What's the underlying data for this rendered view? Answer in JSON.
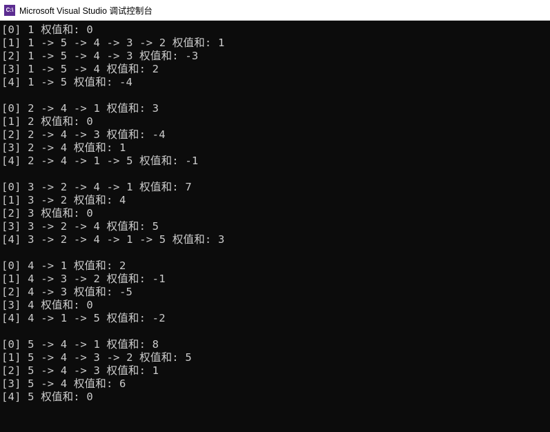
{
  "window": {
    "icon_label": "C:\\",
    "title": "Microsoft Visual Studio 调试控制台"
  },
  "weight_label": "权值和:",
  "arrow": "->",
  "blocks": [
    {
      "rows": [
        {
          "idx": "[0]",
          "path": "1",
          "weight": "0"
        },
        {
          "idx": "[1]",
          "path": "1 -> 5 -> 4 -> 3 -> 2",
          "weight": "1"
        },
        {
          "idx": "[2]",
          "path": "1 -> 5 -> 4 -> 3",
          "weight": "-3"
        },
        {
          "idx": "[3]",
          "path": "1 -> 5 -> 4",
          "weight": "2"
        },
        {
          "idx": "[4]",
          "path": "1 -> 5",
          "weight": "-4"
        }
      ]
    },
    {
      "rows": [
        {
          "idx": "[0]",
          "path": "2 -> 4 -> 1",
          "weight": "3"
        },
        {
          "idx": "[1]",
          "path": "2",
          "weight": "0"
        },
        {
          "idx": "[2]",
          "path": "2 -> 4 -> 3",
          "weight": "-4"
        },
        {
          "idx": "[3]",
          "path": "2 -> 4",
          "weight": "1"
        },
        {
          "idx": "[4]",
          "path": "2 -> 4 -> 1 -> 5",
          "weight": "-1"
        }
      ]
    },
    {
      "rows": [
        {
          "idx": "[0]",
          "path": "3 -> 2 -> 4 -> 1",
          "weight": "7"
        },
        {
          "idx": "[1]",
          "path": "3 -> 2",
          "weight": "4"
        },
        {
          "idx": "[2]",
          "path": "3",
          "weight": "0"
        },
        {
          "idx": "[3]",
          "path": "3 -> 2 -> 4",
          "weight": "5"
        },
        {
          "idx": "[4]",
          "path": "3 -> 2 -> 4 -> 1 -> 5",
          "weight": "3"
        }
      ]
    },
    {
      "rows": [
        {
          "idx": "[0]",
          "path": "4 -> 1",
          "weight": "2"
        },
        {
          "idx": "[1]",
          "path": "4 -> 3 -> 2",
          "weight": "-1"
        },
        {
          "idx": "[2]",
          "path": "4 -> 3",
          "weight": "-5"
        },
        {
          "idx": "[3]",
          "path": "4",
          "weight": "0"
        },
        {
          "idx": "[4]",
          "path": "4 -> 1 -> 5",
          "weight": "-2"
        }
      ]
    },
    {
      "rows": [
        {
          "idx": "[0]",
          "path": "5 -> 4 -> 1",
          "weight": "8"
        },
        {
          "idx": "[1]",
          "path": "5 -> 4 -> 3 -> 2",
          "weight": "5"
        },
        {
          "idx": "[2]",
          "path": "5 -> 4 -> 3",
          "weight": "1"
        },
        {
          "idx": "[3]",
          "path": "5 -> 4",
          "weight": "6"
        },
        {
          "idx": "[4]",
          "path": "5",
          "weight": "0"
        }
      ]
    }
  ]
}
